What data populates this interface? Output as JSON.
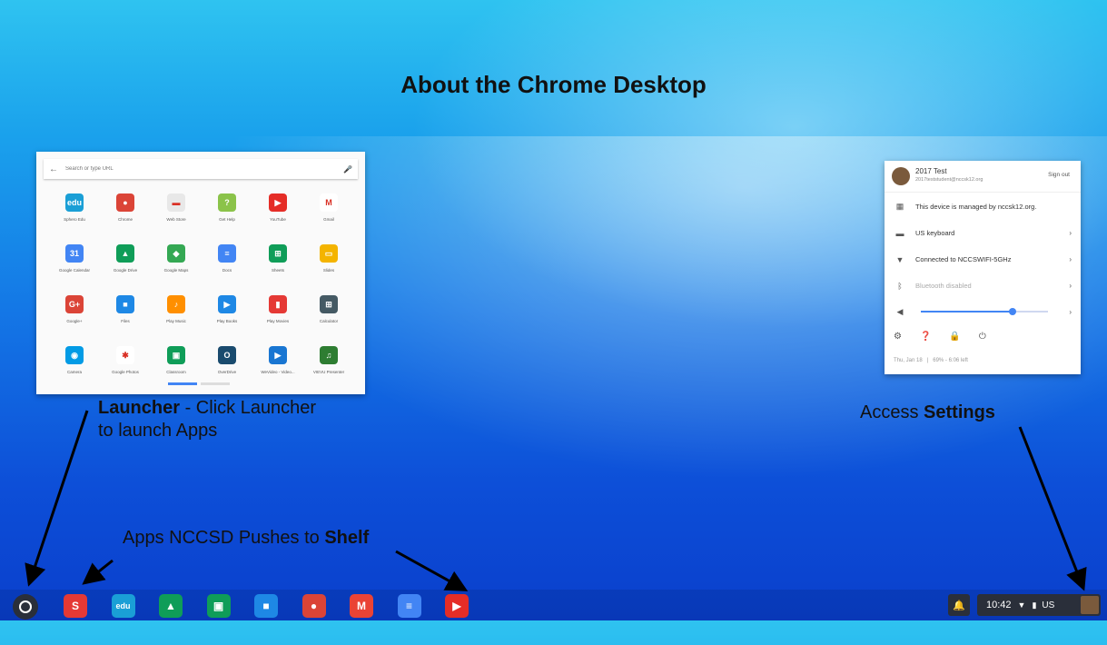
{
  "page_title": "About the Chrome Desktop",
  "launcher_panel": {
    "search_placeholder": "Search or type URL",
    "apps": [
      {
        "label": "Sphero Edu",
        "icon": "edu-icon",
        "glyph": "edu",
        "color": "#1a9fd6"
      },
      {
        "label": "Chrome",
        "icon": "chrome-icon",
        "glyph": "●",
        "color": "#db4437"
      },
      {
        "label": "Web Store",
        "icon": "webstore-icon",
        "glyph": "▬",
        "color": "#e8e8e8"
      },
      {
        "label": "Get Help",
        "icon": "help-icon",
        "glyph": "?",
        "color": "#8bc34a"
      },
      {
        "label": "YouTube",
        "icon": "youtube-icon",
        "glyph": "▶",
        "color": "#e52d27"
      },
      {
        "label": "Gmail",
        "icon": "gmail-icon",
        "glyph": "M",
        "color": "#ffffff"
      },
      {
        "label": "Google Calendar",
        "icon": "calendar-icon",
        "glyph": "31",
        "color": "#4285f4"
      },
      {
        "label": "Google Drive",
        "icon": "drive-icon",
        "glyph": "▲",
        "color": "#0f9d58"
      },
      {
        "label": "Google Maps",
        "icon": "maps-icon",
        "glyph": "◆",
        "color": "#34a853"
      },
      {
        "label": "Docs",
        "icon": "docs-icon",
        "glyph": "≡",
        "color": "#4285f4"
      },
      {
        "label": "Sheets",
        "icon": "sheets-icon",
        "glyph": "⊞",
        "color": "#0f9d58"
      },
      {
        "label": "Slides",
        "icon": "slides-icon",
        "glyph": "▭",
        "color": "#f4b400"
      },
      {
        "label": "Google+",
        "icon": "google-plus-icon",
        "glyph": "G+",
        "color": "#db4437"
      },
      {
        "label": "Files",
        "icon": "files-icon",
        "glyph": "■",
        "color": "#1e88e5"
      },
      {
        "label": "Play Music",
        "icon": "play-music-icon",
        "glyph": "♪",
        "color": "#ff8f00"
      },
      {
        "label": "Play Books",
        "icon": "play-books-icon",
        "glyph": "▶",
        "color": "#1e88e5"
      },
      {
        "label": "Play Movies",
        "icon": "play-movies-icon",
        "glyph": "▮",
        "color": "#e53935"
      },
      {
        "label": "Calculator",
        "icon": "calculator-icon",
        "glyph": "⊞",
        "color": "#455a64"
      },
      {
        "label": "Camera",
        "icon": "camera-icon",
        "glyph": "◉",
        "color": "#039be5"
      },
      {
        "label": "Google Photos",
        "icon": "photos-icon",
        "glyph": "✱",
        "color": "#ffffff"
      },
      {
        "label": "Classroom",
        "icon": "classroom-icon",
        "glyph": "▣",
        "color": "#0f9d58"
      },
      {
        "label": "OverDrive",
        "icon": "overdrive-icon",
        "glyph": "O",
        "color": "#1a4b6e"
      },
      {
        "label": "WeVideo - Video...",
        "icon": "wevideo-icon",
        "glyph": "▶",
        "color": "#1976d2"
      },
      {
        "label": "VIEVU Presenter",
        "icon": "vievu-icon",
        "glyph": "♫",
        "color": "#2e7d32"
      }
    ]
  },
  "settings_panel": {
    "user_name": "2017 Test",
    "user_email": "2017teststudent@nccsk12.org",
    "sign_out_label": "Sign out",
    "managed_text": "This device is managed by nccsk12.org.",
    "keyboard_text": "US keyboard",
    "network_text": "Connected to NCCSWIFI-5GHz",
    "bluetooth_text": "Bluetooth disabled",
    "volume_level": 0.72,
    "footer_date": "Thu, Jan 18",
    "footer_battery": "69% - 6:06 left"
  },
  "callouts": {
    "launcher_bold": "Launcher",
    "launcher_rest": " - Click Launcher",
    "launcher_line2": "to launch Apps",
    "settings_pre": "Access ",
    "settings_bold": "Settings",
    "shelf_pre": "Apps NCCSD Pushes to ",
    "shelf_bold": "Shelf"
  },
  "shelf": {
    "apps": [
      {
        "name": "sketchup-icon",
        "glyph": "S",
        "color": "#e53935"
      },
      {
        "name": "edu-icon",
        "glyph": "edu",
        "color": "#1a9fd6"
      },
      {
        "name": "drive-icon",
        "glyph": "▲",
        "color": "#0f9d58"
      },
      {
        "name": "classroom-icon",
        "glyph": "▣",
        "color": "#0f9d58"
      },
      {
        "name": "files-icon",
        "glyph": "■",
        "color": "#1e88e5"
      },
      {
        "name": "chrome-icon",
        "glyph": "●",
        "color": "#db4437"
      },
      {
        "name": "gmail-icon",
        "glyph": "M",
        "color": "#ea4335"
      },
      {
        "name": "docs-icon",
        "glyph": "≡",
        "color": "#4285f4"
      },
      {
        "name": "youtube-icon",
        "glyph": "▶",
        "color": "#e52d27"
      }
    ],
    "time": "10:42",
    "input_method": "US"
  }
}
